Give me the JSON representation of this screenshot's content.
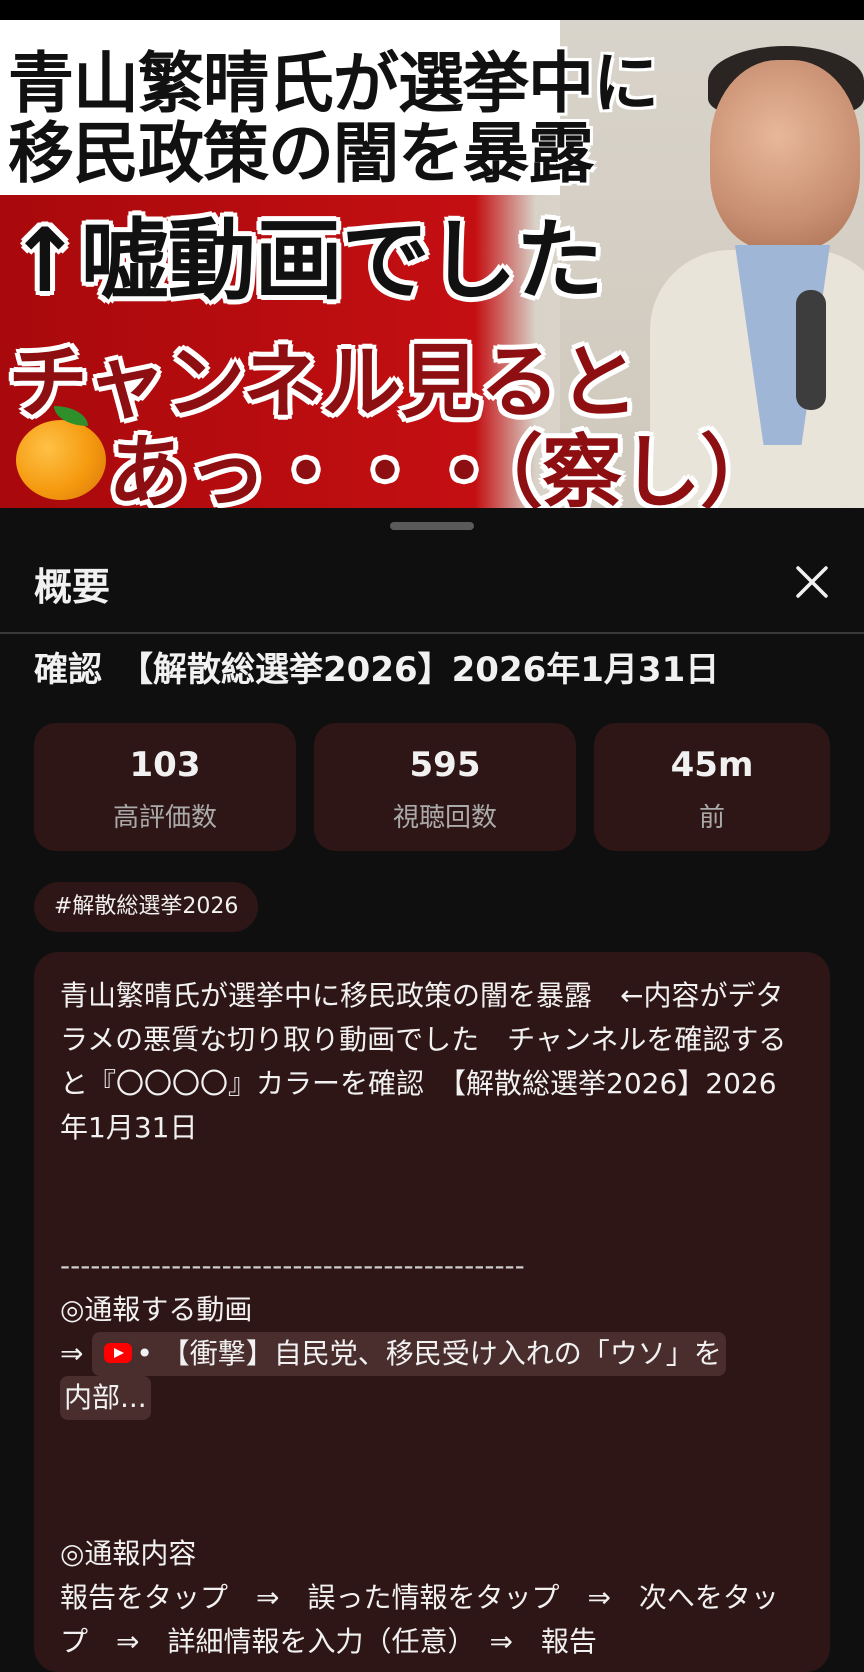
{
  "thumbnail": {
    "line1": "青山繁晴氏が選挙中に",
    "line2": "移民政策の闇を暴露",
    "line3": "↑嘘動画でした",
    "line4": "チャンネル見ると",
    "line5": "あっ・・・（察し）",
    "colors": {
      "red_bg": "#c40f12",
      "dark_red_text": "#8e0f12"
    }
  },
  "sheet": {
    "title": "概要",
    "close_icon": "close-icon",
    "video_title": "確認　【解散総選挙2026】2026年1月31日",
    "stats": [
      {
        "value": "103",
        "label": "高評価数"
      },
      {
        "value": "595",
        "label": "視聴回数"
      },
      {
        "value": "45m",
        "label": "前"
      }
    ],
    "hashtag": "#解散総選挙2026",
    "description": {
      "para1": "青山繁晴氏が選挙中に移民政策の闇を暴露　←内容がデタラメの悪質な切り取り動画でした　チャンネルを確認すると『〇〇〇〇』カラーを確認　【解散総選挙2026】2026年1月31日",
      "separator": "----------------------------------------------",
      "heading1": "◎通報する動画",
      "arrow": "⇒",
      "link_prefix": "•",
      "link_text": "【衝撃】自民党、移民受け入れの「ウソ」を",
      "link_text_cont": "内部...",
      "heading2": "◎通報内容",
      "steps": "報告をタップ　⇒　誤った情報をタップ　⇒　次へをタップ　⇒　詳細情報を入力（任意）　⇒　報告"
    }
  }
}
